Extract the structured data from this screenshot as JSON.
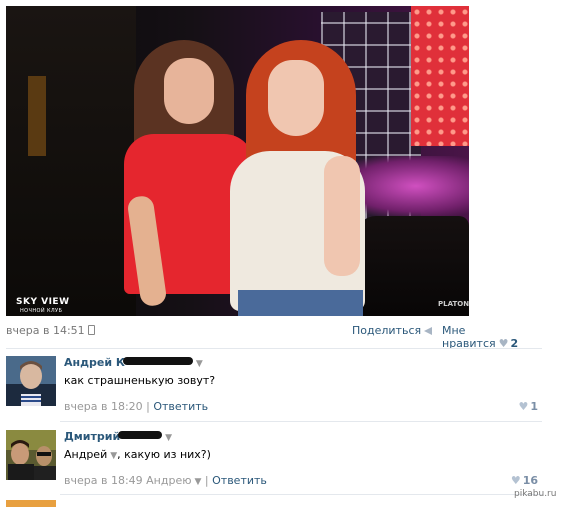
{
  "photo": {
    "logo_title": "SKY VIEW",
    "logo_subtitle": "НОЧНОЙ КЛУБ",
    "watermark": "PLATONOV"
  },
  "post": {
    "time": "вчера в 14:51",
    "share_label": "Поделиться",
    "like_label": "Мне нравится",
    "like_count": "2"
  },
  "comments": [
    {
      "author": "Андрей К",
      "text": "как страшненькую зовут?",
      "time": "вчера в 18:20",
      "reply_label": "Ответить",
      "likes": "1"
    },
    {
      "author": "Дмитрий",
      "text_mention": "Андрей",
      "text": ", какую из них?)",
      "time": "вчера в 18:49",
      "reply_to": "Андрею",
      "reply_label": "Ответить",
      "likes": "16"
    }
  ],
  "site_watermark": "pikabu.ru",
  "colors": {
    "link": "#2b587a",
    "muted": "#999999",
    "separator": "#e4e8ed"
  }
}
